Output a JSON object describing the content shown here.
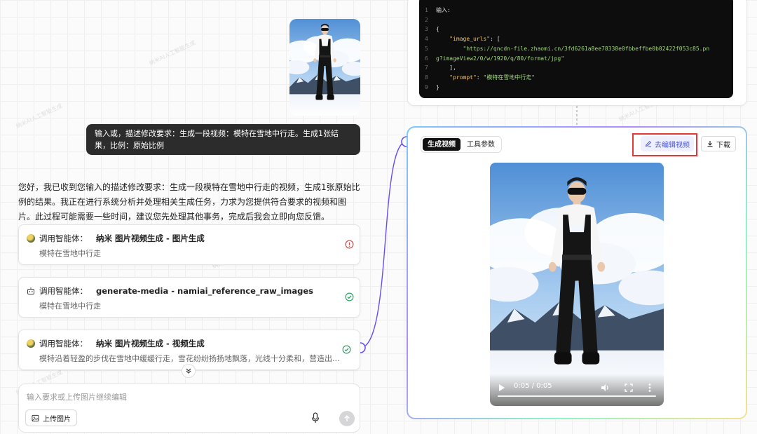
{
  "user_message": {
    "text": "输入或，描述修改要求：生成一段视频：模特在雪地中行走。生成1张结果，比例：原始比例"
  },
  "assistant_message": {
    "text": "您好，我已收到您输入的描述修改要求：生成一段模特在雪地中行走的视频，生成1张原始比例的结果。我正在进行系统分析并处理相关生成任务，力求为您提供符合要求的视频和图片。此过程可能需要一些时间，建议您先处理其他事务，完成后我会立即向您反馈。"
  },
  "agent_calls": [
    {
      "prefix": "调用智能体：",
      "name": "纳米 图片视频生成 - 图片生成",
      "desc": "模特在雪地中行走",
      "status": "error",
      "icon": "avatar-icon"
    },
    {
      "prefix": "调用智能体：",
      "name": "generate-media - namiai_reference_raw_images",
      "desc": "模特在雪地中行走",
      "status": "success",
      "icon": "robot-icon"
    },
    {
      "prefix": "调用智能体：",
      "name": "纳米 图片视频生成 - 视频生成",
      "desc": "模特沿着轻盈的步伐在雪地中缓缓行走，雪花纷纷扬扬地飘落，光线十分柔和，营造出...",
      "status": "success",
      "icon": "avatar-icon"
    }
  ],
  "input": {
    "placeholder": "输入要求或上传图片继续编辑",
    "value": "",
    "upload_label": "上传图片"
  },
  "code": {
    "lines": [
      "输入:",
      "",
      "{",
      "    \"image_urls\": [",
      "        \"https://qncdn-file.zhaomi.cn/3fd6261a8ee78338e0fbbeffbe0b02422f053c85.pn",
      "g?imageView2/0/w/1920/q/80/format/jpg\"",
      "    ],",
      "    \"prompt\": \"模特在雪地中行走\"",
      "}"
    ],
    "line_numbers": [
      "1",
      "2",
      "3",
      "4",
      "5",
      "6",
      "7",
      "8",
      "9"
    ]
  },
  "video_panel": {
    "tabs": [
      {
        "label": "生成视频",
        "active": true
      },
      {
        "label": "工具参数",
        "active": false
      }
    ],
    "edit_label": "去编辑视频",
    "download_label": "下载",
    "time": "0:05 / 0:05"
  },
  "watermark": "纳米AI人工智能生成",
  "colors": {
    "accent": "#4a57d8",
    "highlight": "#e53935",
    "error": "#e53935",
    "success": "#22a35a",
    "connector": "#6b4cf0"
  }
}
